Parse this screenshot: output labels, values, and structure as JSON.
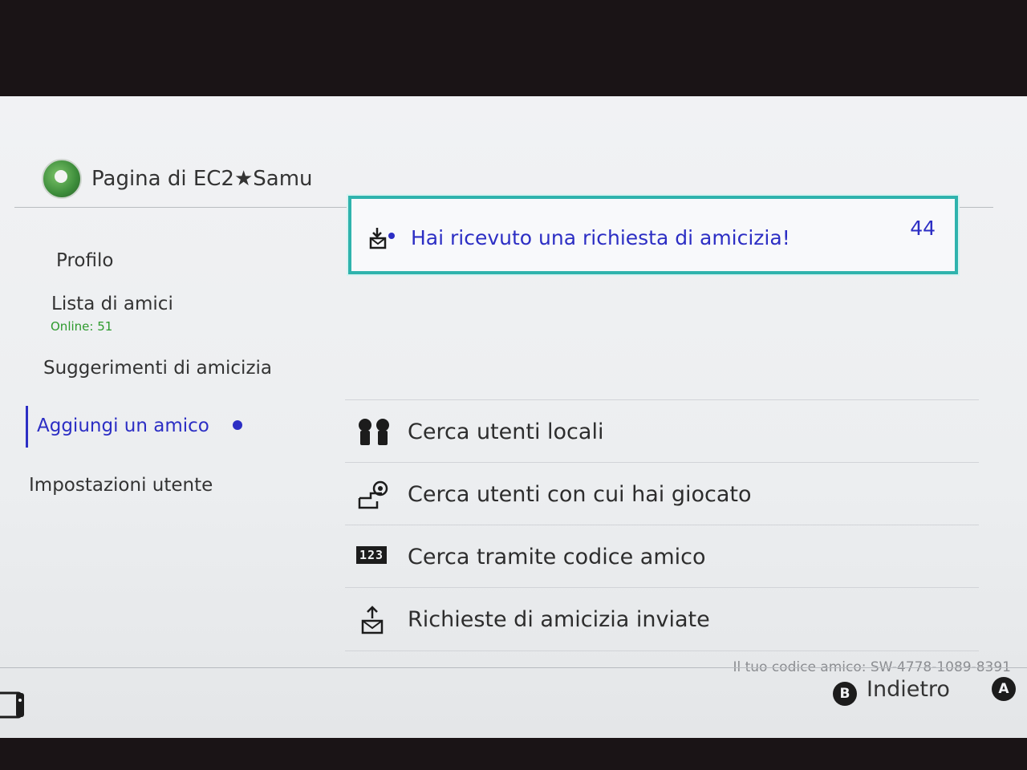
{
  "header": {
    "title": "Pagina di EC2★Samu"
  },
  "sidebar": {
    "items": [
      {
        "label": "Profilo"
      },
      {
        "label": "Lista di amici",
        "sub": "Online: 51"
      },
      {
        "label": "Suggerimenti di amicizia"
      },
      {
        "label": "Aggiungi un amico",
        "active": true
      },
      {
        "label": "Impostazioni utente"
      }
    ]
  },
  "main": {
    "request": {
      "label": "Hai ricevuto una richiesta di amicizia!",
      "count": "44"
    },
    "options": [
      {
        "label": "Cerca utenti locali",
        "icon": "local-users-icon"
      },
      {
        "label": "Cerca utenti con cui hai giocato",
        "icon": "played-with-icon"
      },
      {
        "label": "Cerca tramite codice amico",
        "icon": "code-123-icon",
        "icon_text": "123"
      },
      {
        "label": "Richieste di amicizia inviate",
        "icon": "sent-requests-icon"
      }
    ],
    "friend_code": "Il tuo codice amico: SW-4778-1089-8391"
  },
  "footer": {
    "b_button": "B",
    "back_label": "Indietro",
    "a_button": "A"
  },
  "colors": {
    "accent": "#2c2ec4",
    "highlight_border": "#2fb3ad",
    "online": "#2d9a2d"
  }
}
